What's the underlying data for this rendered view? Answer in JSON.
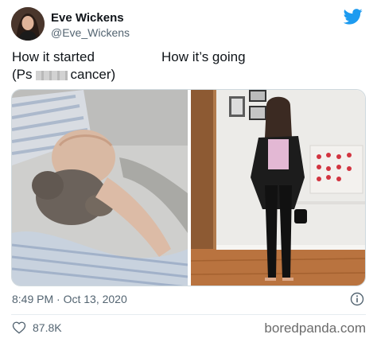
{
  "user": {
    "name": "Eve Wickens",
    "handle": "@Eve_Wickens",
    "avatar_icon": "profile-photo"
  },
  "tweet": {
    "caption_left_line1": "How it started",
    "caption_left_line2_start": "(Ps",
    "caption_left_line2_end": "cancer)",
    "caption_right": "How it’s going"
  },
  "meta": {
    "timestamp": "8:49 PM · Oct 13, 2020"
  },
  "actions": {
    "likes": "87.8K"
  },
  "watermark": "boredpanda.com",
  "colors": {
    "twitter_blue": "#1d9bf0",
    "muted_text": "#536471"
  }
}
